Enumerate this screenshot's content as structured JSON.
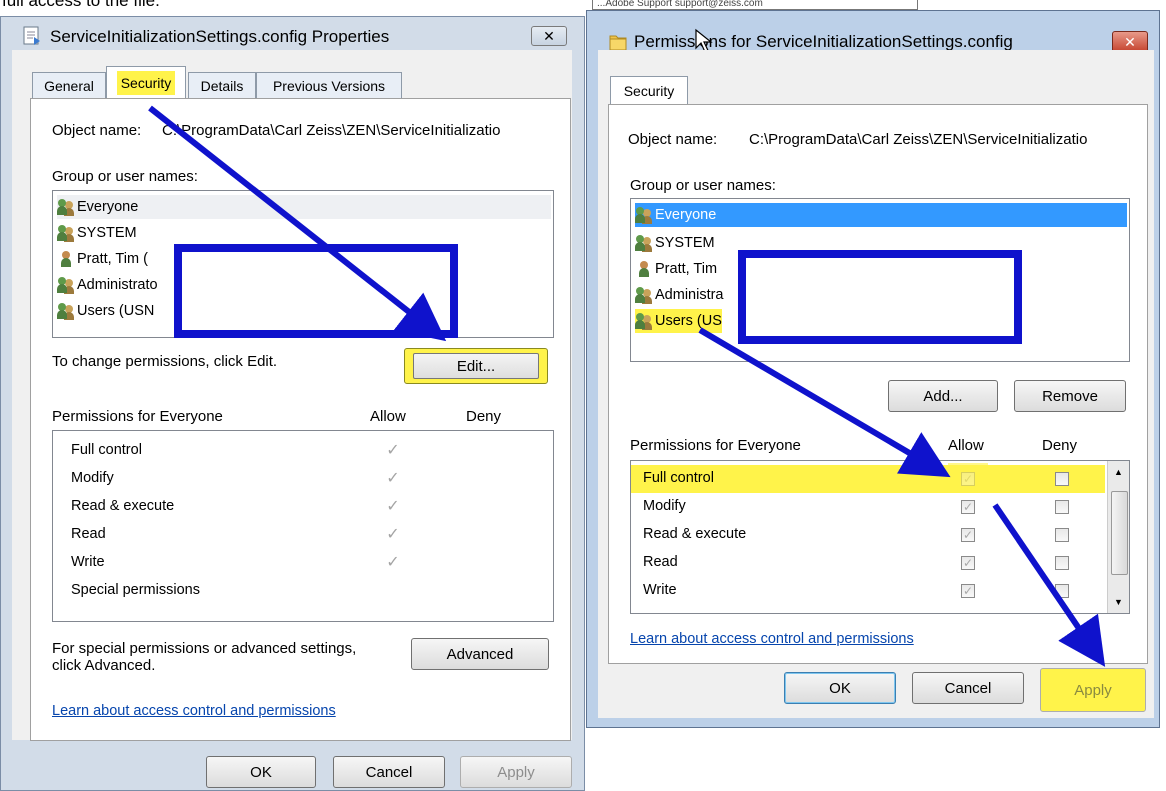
{
  "caption_fragment": "full access to the file.",
  "behind_window_text": "...Adobe Support  support@zeiss.com",
  "left_dialog": {
    "title": "ServiceInitializationSettings.config Properties",
    "close_label": "✕",
    "tabs": [
      "General",
      "Security",
      "Details",
      "Previous Versions"
    ],
    "selected_tab": "Security",
    "object_name_label": "Object name:",
    "object_name_value": "C:\\ProgramData\\Carl Zeiss\\ZEN\\ServiceInitializatio",
    "group_label": "Group or user names:",
    "users": [
      "Everyone",
      "SYSTEM",
      "Pratt, Tim (",
      "Administrato",
      "Users (USN"
    ],
    "change_text": "To change permissions, click Edit.",
    "edit_button": "Edit...",
    "perm_header": "Permissions for Everyone",
    "allow_header": "Allow",
    "deny_header": "Deny",
    "permissions": [
      "Full control",
      "Modify",
      "Read & execute",
      "Read",
      "Write",
      "Special permissions"
    ],
    "allow_checked": [
      true,
      true,
      true,
      true,
      true,
      false
    ],
    "special_text_1": "For special permissions or advanced settings,",
    "special_text_2": "click Advanced.",
    "advanced_button": "Advanced",
    "learn_link": "Learn about access control and permissions",
    "ok_button": "OK",
    "cancel_button": "Cancel",
    "apply_button": "Apply"
  },
  "right_dialog": {
    "title": "Permissions for ServiceInitializationSettings.config",
    "close_label": "✕",
    "tab": "Security",
    "object_name_label": "Object name:",
    "object_name_value": "C:\\ProgramData\\Carl Zeiss\\ZEN\\ServiceInitializatio",
    "group_label": "Group or user names:",
    "users": [
      "Everyone",
      "SYSTEM",
      "Pratt, Tim",
      "Administra",
      "Users (US"
    ],
    "selected_user": "Everyone",
    "add_button": "Add...",
    "remove_button": "Remove",
    "perm_header": "Permissions for Everyone",
    "allow_header": "Allow",
    "deny_header": "Deny",
    "permissions": [
      "Full control",
      "Modify",
      "Read & execute",
      "Read",
      "Write"
    ],
    "learn_link": "Learn about access control and permissions",
    "ok_button": "OK",
    "cancel_button": "Cancel",
    "apply_button": "Apply"
  },
  "colors": {
    "highlight": "#fff34a",
    "annotation_blue": "#0f12cc",
    "selection": "#3399ff"
  }
}
